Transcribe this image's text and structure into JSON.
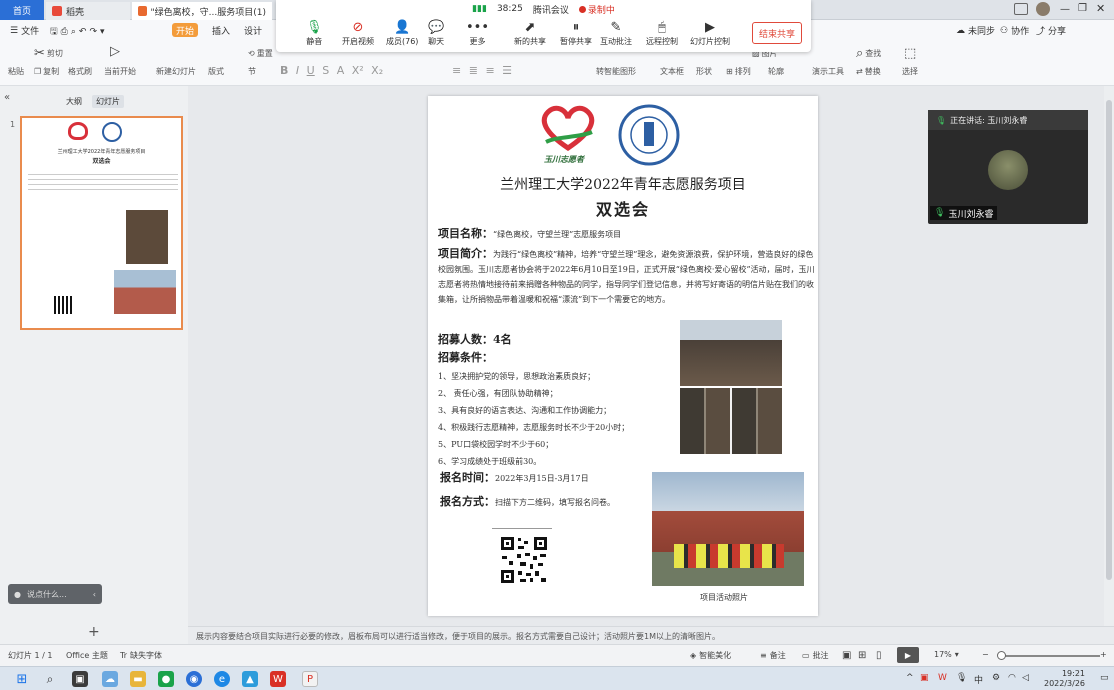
{
  "tabs": {
    "home": "首页",
    "shell": "稻壳",
    "doc": "\"绿色离校，守...服务项目(1)"
  },
  "meeting": {
    "signal_time": "38:25",
    "app_name": "腾讯会议",
    "recording": "录制中",
    "buttons": [
      {
        "label": "静音",
        "icon": "microphone-icon"
      },
      {
        "label": "开启视频",
        "icon": "video-off-icon"
      },
      {
        "label": "成员(76)",
        "icon": "members-icon"
      },
      {
        "label": "聊天",
        "icon": "chat-icon"
      },
      {
        "label": "更多",
        "icon": "more-icon"
      },
      {
        "label": "新的共享",
        "icon": "share-icon"
      },
      {
        "label": "暂停共享",
        "icon": "pause-icon"
      },
      {
        "label": "互动批注",
        "icon": "annotate-icon"
      },
      {
        "label": "远程控制",
        "icon": "remote-icon"
      },
      {
        "label": "幻灯片控制",
        "icon": "slides-icon"
      }
    ],
    "end_share": "结束共享"
  },
  "ribbon_top": {
    "file": "文件",
    "start": "开始",
    "insert": "插入",
    "design": "设计",
    "sync": "未同步",
    "collab": "协作",
    "share": "分享"
  },
  "ribbon": {
    "cut": "剪切",
    "copy": "复制",
    "paste": "粘贴",
    "format_painter": "格式刷",
    "play_from_current": "当前开始",
    "new_slide": "新建幻灯片",
    "layout": "版式",
    "section": "节",
    "reset": "重置",
    "textbox": "文本框",
    "shape": "形状",
    "arrange": "排列",
    "outline": "轮廓",
    "convert": "转智能图形",
    "picture": "图片",
    "presentation_tools": "演示工具",
    "find": "查找",
    "replace": "替换",
    "select": "选择"
  },
  "panel": {
    "outline_tab": "大纲",
    "slides_tab": "幻灯片",
    "slide_number": "1",
    "narration": "说点什么..."
  },
  "slide": {
    "logo_text": "玉川志愿者",
    "title": "兰州理工大学2022年青年志愿服务项目",
    "subtitle": "双选会",
    "name_label": "项目名称：",
    "name_value": "“绿色离校，守望兰理”志愿服务项目",
    "intro_label": "项目简介：",
    "intro_text": "为践行“绿色离校”精神，培养“守望兰理”理念，避免资源浪费，保护环境，营造良好的绿色校园氛围。玉川志愿者协会将于2022年6月10日至19日，正式开展“绿色离校·爱心留校”活动，届时，玉川志愿者将热情地接待前来捐赠各种物品的同学，指导同学们登记信息，并将写好寄语的明信片贴在我们的收集箱，让所捐物品带着温暖和祝福“漂流”到下一个需要它的地方。",
    "recruit_label": "招募人数：",
    "recruit_value": "4名",
    "cond_label": "招募条件：",
    "conditions": [
      "1、坚决拥护党的领导，思想政治素质良好；",
      "2、 责任心强，有团队协助精神；",
      "3、具有良好的语言表达、沟通和工作协调能力；",
      "4、积极践行志愿精神，志愿服务时长不少于20小时；",
      "5、PU口袋校园学时不少于60；",
      "6、学习成绩处于班级前30。"
    ],
    "time_label": "报名时间：",
    "time_value": "2022年3月15日-3月17日",
    "method_label": "报名方式：",
    "method_value": "扫描下方二维码，填写报名问卷。",
    "photo_caption": "项目活动照片"
  },
  "video": {
    "speaking": "正在讲话: 玉川刘永睿",
    "name": "玉川刘永睿"
  },
  "notes": "展示内容要结合项目实际进行必要的修改，眉板布局可以进行适当修改，便于项目的展示。报名方式需要自己设计；活动照片要1M以上的清晰图片。",
  "status": {
    "slide_info": "幻灯片 1 / 1",
    "theme": "Office 主题",
    "missing_font": "缺失字体",
    "beautify": "智能美化",
    "notes_btn": "备注",
    "comment_btn": "批注",
    "zoom": "17%"
  },
  "taskbar": {
    "ime": "中",
    "time": "19:21",
    "date": "2022/3/26"
  },
  "colors": {
    "accent_blue": "#2b6fd6",
    "start_orange": "#f39c3b",
    "end_share_red": "#e04a3b",
    "thumb_border": "#e98b4d"
  }
}
